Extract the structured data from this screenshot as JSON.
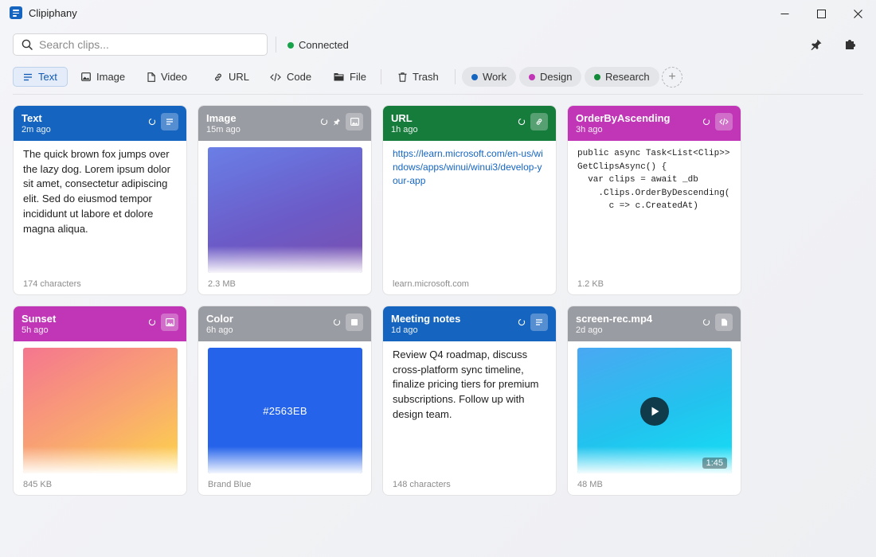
{
  "app": {
    "title": "Clipiphany"
  },
  "search": {
    "placeholder": "Search clips...",
    "value": ""
  },
  "status": {
    "label": "Connected",
    "color": "#16a34a"
  },
  "filters": {
    "types": [
      {
        "label": "Text",
        "icon": "text-lines-icon",
        "active": true
      },
      {
        "label": "Image",
        "icon": "image-icon",
        "active": false
      },
      {
        "label": "Video",
        "icon": "document-icon",
        "active": false
      },
      {
        "label": "URL",
        "icon": "link-icon",
        "active": false
      },
      {
        "label": "Code",
        "icon": "code-icon",
        "active": false
      },
      {
        "label": "File",
        "icon": "folder-icon",
        "active": false
      },
      {
        "label": "Trash",
        "icon": "trash-icon",
        "active": false
      }
    ],
    "tags": [
      {
        "label": "Work",
        "color": "#1565c0"
      },
      {
        "label": "Design",
        "color": "#c036b6"
      },
      {
        "label": "Research",
        "color": "#138a3a"
      }
    ],
    "add_label": "+"
  },
  "cards": [
    {
      "title": "Text",
      "time": "2m ago",
      "color": "#1565c0",
      "body": "The quick brown fox jumps over the lazy dog. Lorem ipsum dolor sit amet, consectetur adipiscing elit. Sed do eiusmod tempor incididunt ut labore et dolore magna aliqua.",
      "footer": "174 characters"
    },
    {
      "title": "Image",
      "time": "15m ago",
      "color": "#9a9ca3",
      "footer": "2.3 MB",
      "pinned": true
    },
    {
      "title": "URL",
      "time": "1h ago",
      "color": "#167c3c",
      "body": "https://learn.microsoft.com/en-us/windows/apps/winui/winui3/develop-your-app",
      "footer": "learn.microsoft.com"
    },
    {
      "title": "OrderByAscending",
      "time": "3h ago",
      "color": "#c036b6",
      "body": "public async Task<List<Clip>>\nGetClipsAsync() {\n  var clips = await _db\n    .Clips.OrderByDescending(\n      c => c.CreatedAt)",
      "footer": "1.2 KB"
    },
    {
      "title": "Sunset",
      "time": "5h ago",
      "color": "#c036b6",
      "footer": "845 KB"
    },
    {
      "title": "Color",
      "time": "6h ago",
      "color": "#9a9ca3",
      "swatch": "#2563EB",
      "footer": "Brand Blue"
    },
    {
      "title": "Meeting notes",
      "time": "1d ago",
      "color": "#1565c0",
      "body": "Review Q4 roadmap, discuss cross-platform sync timeline, finalize pricing tiers for premium subscriptions. Follow up with design team.",
      "footer": "148 characters"
    },
    {
      "title": "screen-rec.mp4",
      "time": "2d ago",
      "color": "#9a9ca3",
      "duration": "1:45",
      "footer": "48 MB"
    }
  ]
}
